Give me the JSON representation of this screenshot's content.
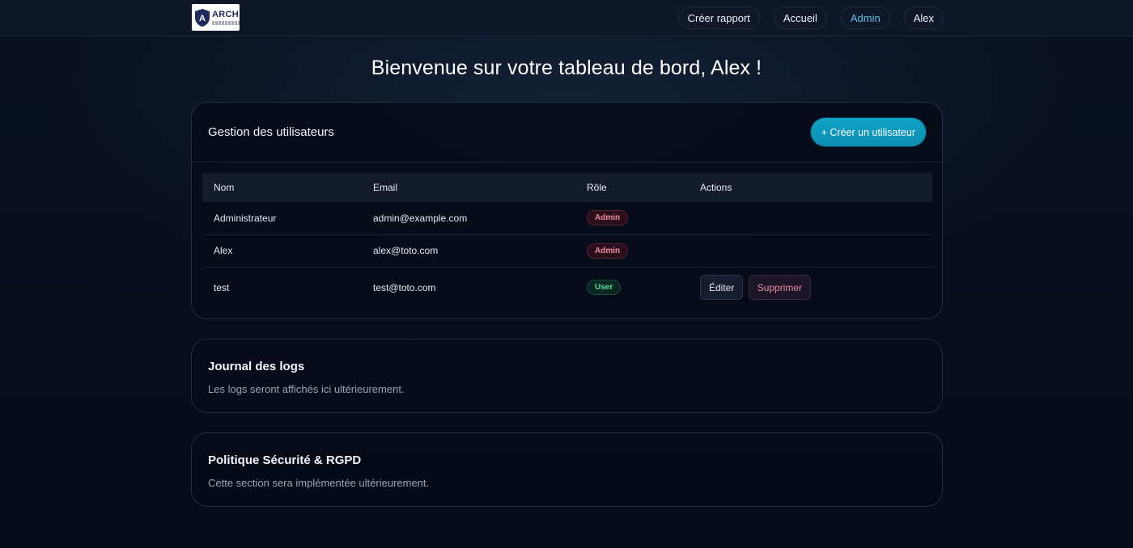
{
  "brand": {
    "name": "ARCH"
  },
  "nav": {
    "items": [
      {
        "label": "Créer rapport"
      },
      {
        "label": "Accueil"
      },
      {
        "label": "Admin",
        "active": true
      },
      {
        "label": "Alex"
      }
    ]
  },
  "page": {
    "title": "Bienvenue sur votre tableau de bord, Alex !"
  },
  "users": {
    "title": "Gestion des utilisateurs",
    "create_label": "+ Créer un utilisateur",
    "columns": [
      "Nom",
      "Email",
      "Rôle",
      "Actions"
    ],
    "rows": [
      {
        "name": "Administrateur",
        "email": "admin@example.com",
        "role": "Admin"
      },
      {
        "name": "Alex",
        "email": "alex@toto.com",
        "role": "Admin"
      },
      {
        "name": "test",
        "email": "test@toto.com",
        "role": "User",
        "actions": {
          "edit": "Éditer",
          "delete": "Supprimer"
        }
      }
    ]
  },
  "logs": {
    "title": "Journal des logs",
    "text": "Les logs seront affichés ici ultérieurement."
  },
  "rgpd": {
    "title": "Politique Sécurité & RGPD",
    "text": "Cette section sera implémentée ultérieurement."
  },
  "colors": {
    "accent": "#0a9cc2",
    "nav_active": "#5fc4e8",
    "admin_badge": "#f08aa3",
    "user_badge": "#4fe0a5"
  }
}
